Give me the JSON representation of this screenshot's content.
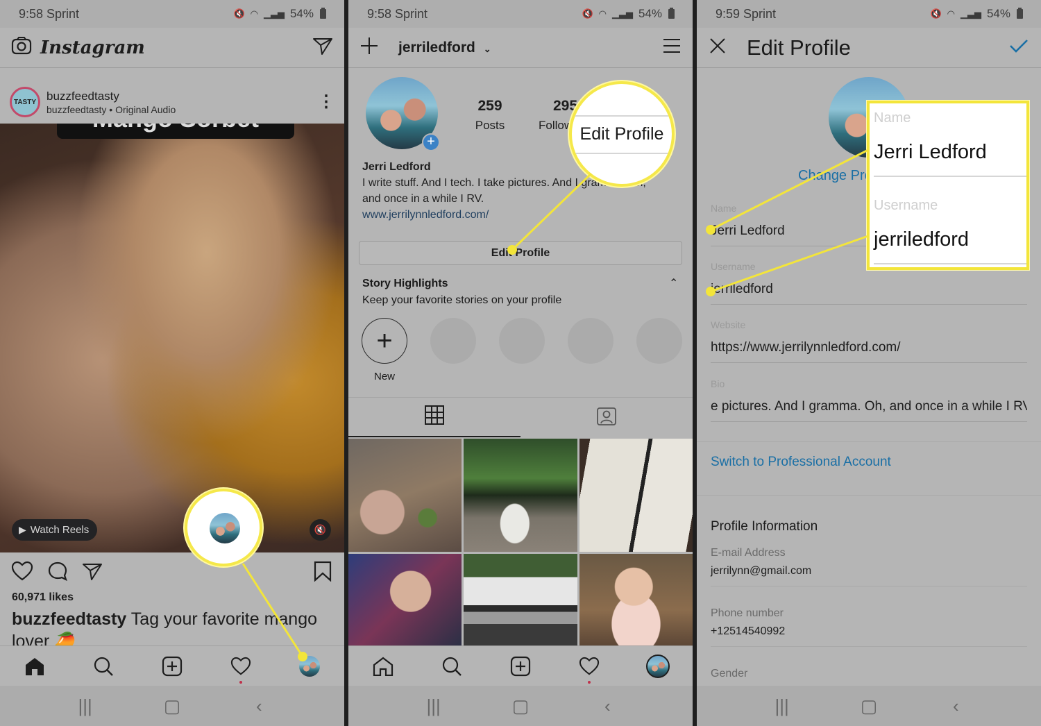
{
  "panels": {
    "feed": {
      "status": {
        "time": "9:58 Sprint",
        "battery": "54%"
      },
      "header": {
        "logo": "Instagram",
        "camera_icon": "camera-icon",
        "direct_icon": "paper-plane-icon"
      },
      "post": {
        "account": "buzzfeedtasty",
        "subtitle": "buzzfeedtasty • Original Audio",
        "avatar_text": "TASTY",
        "overlay_title": "Mango Sorbet",
        "watch_reels": "Watch Reels",
        "likes": "60,971 likes",
        "caption_user": "buzzfeedtasty",
        "caption_text": " Tag your favorite mango lover 🥭"
      },
      "nav": [
        "home-icon",
        "search-icon",
        "add-post-icon",
        "activity-heart-icon",
        "profile-avatar"
      ]
    },
    "profile": {
      "status": {
        "time": "9:58 Sprint",
        "battery": "54%"
      },
      "username": "jerriledford",
      "stats": [
        {
          "value": "259",
          "label": "Posts"
        },
        {
          "value": "295",
          "label": "Follow"
        }
      ],
      "name": "Jerri Ledford",
      "bio": "I write stuff. And I tech. I take pictures. And I gramma. Oh, and once in a while I RV.",
      "website": "www.jerrilynnledford.com/",
      "edit_profile": "Edit Profile",
      "callout_label": "Edit Profile",
      "highlights": {
        "title": "Story Highlights",
        "subtitle": "Keep your favorite stories on your profile",
        "new_label": "New"
      }
    },
    "edit": {
      "status": {
        "time": "9:59 Sprint",
        "battery": "54%"
      },
      "title": "Edit Profile",
      "change_photo": "Change Profile Photo",
      "fields": [
        {
          "label": "Name",
          "value": "Jerri Ledford"
        },
        {
          "label": "Username",
          "value": "jerriledford"
        },
        {
          "label": "Website",
          "value": "https://www.jerrilynnledford.com/"
        },
        {
          "label": "Bio",
          "value": "e pictures. And I gramma. Oh, and once in a while I RV."
        }
      ],
      "switch_pro": "Switch to Professional Account",
      "profile_info": {
        "title": "Profile Information",
        "items": [
          {
            "label": "E-mail Address",
            "value": "jerrilynn@gmail.com"
          },
          {
            "label": "Phone number",
            "value": "+12514540992"
          },
          {
            "label": "Gender",
            "value": ""
          }
        ]
      },
      "callout": {
        "name_label": "Name",
        "name_value": "Jerri Ledford",
        "username_label": "Username",
        "username_value": "jerriledford"
      }
    }
  },
  "colors": {
    "highlight": "#f3e53a",
    "link_blue": "#1a6fa5",
    "accent_blue": "#3b82c6"
  }
}
